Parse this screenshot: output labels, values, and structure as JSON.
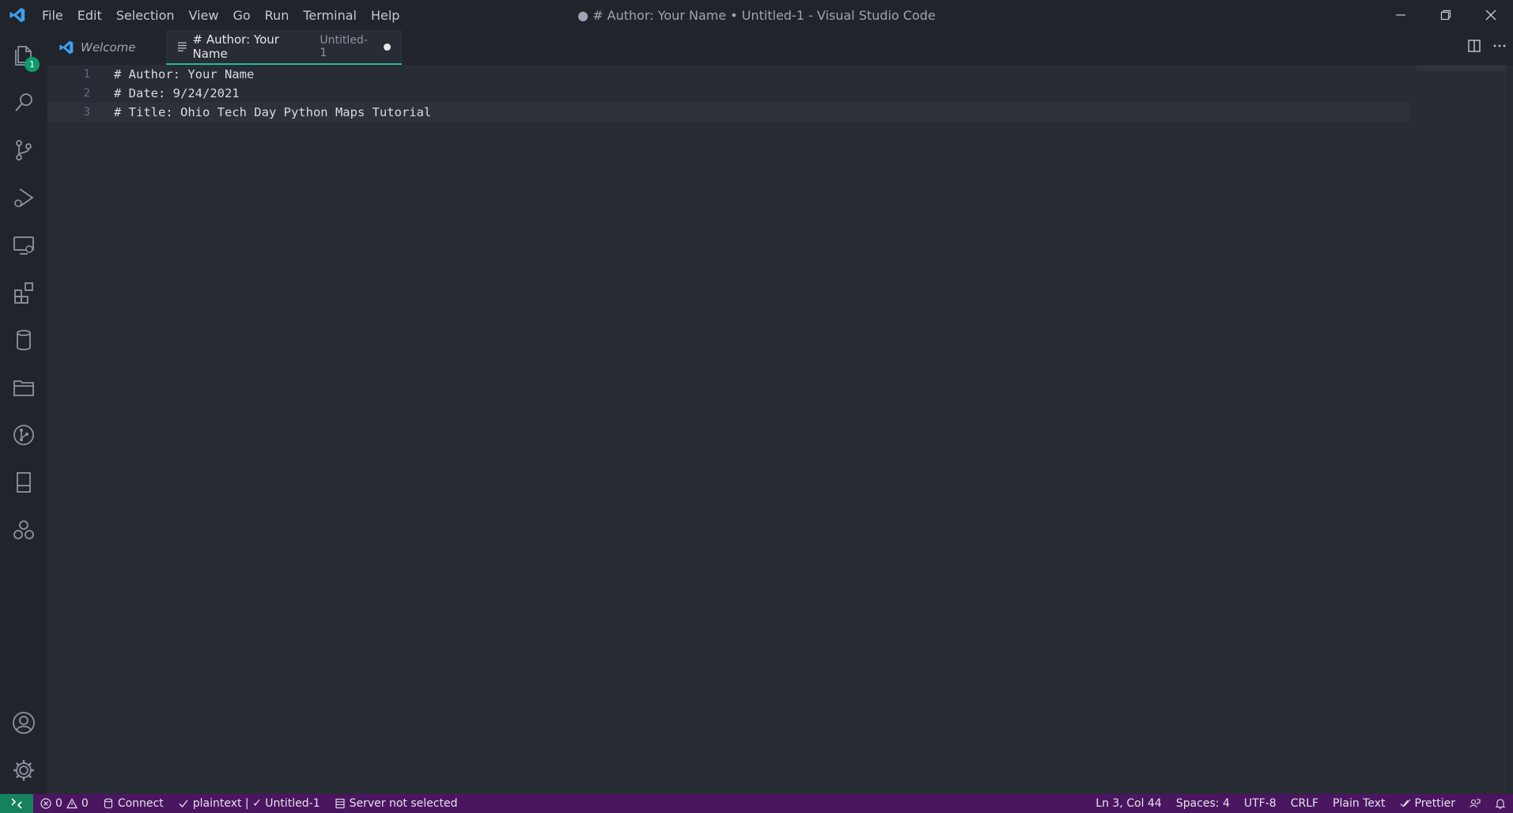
{
  "window": {
    "title": "● # Author: Your Name • Untitled-1 - Visual Studio Code",
    "menu": [
      "File",
      "Edit",
      "Selection",
      "View",
      "Go",
      "Run",
      "Terminal",
      "Help"
    ]
  },
  "activity_bar": {
    "explorer_badge": "1",
    "icons": [
      "explorer-icon",
      "search-icon",
      "source-control-icon",
      "run-debug-icon",
      "remote-explorer-icon",
      "extensions-icon",
      "database-icon",
      "project-manager-icon",
      "git-graph-icon",
      "notebook-icon",
      "live-share-icon",
      "accounts-icon",
      "settings-gear-icon"
    ]
  },
  "tabs": [
    {
      "label": "Welcome",
      "active": false
    },
    {
      "label": "# Author: Your Name",
      "description": "Untitled-1",
      "active": true,
      "dirty": true
    }
  ],
  "editor": {
    "lines": [
      {
        "number": "1",
        "text": "# Author: Your Name"
      },
      {
        "number": "2",
        "text": "# Date: 9/24/2021"
      },
      {
        "number": "3",
        "text": "# Title: Ohio Tech Day Python Maps Tutorial"
      }
    ],
    "current_line": 3
  },
  "status_bar": {
    "errors": "0",
    "warnings": "0",
    "connect": "Connect",
    "language_status": "plaintext | ✓ Untitled-1",
    "server": "Server not selected",
    "position": "Ln 3, Col 44",
    "spaces": "Spaces: 4",
    "encoding": "UTF-8",
    "eol": "CRLF",
    "language": "Plain Text",
    "prettier": "Prettier"
  },
  "colors": {
    "accent_tab": "#2bb89a",
    "status_bar": "#4b1660",
    "remote": "#16825d",
    "vscode_blue": "#3aa0f3"
  }
}
